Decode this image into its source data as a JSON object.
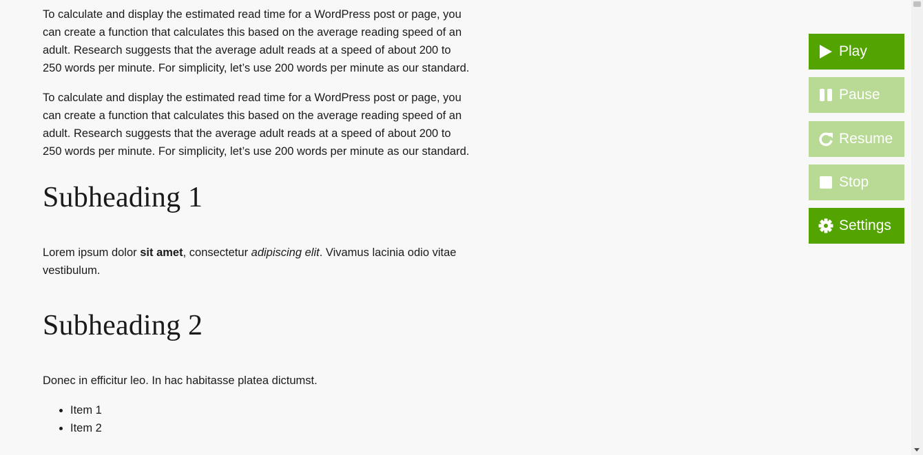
{
  "article": {
    "paragraph_1": "To calculate and display the estimated read time for a WordPress post or page, you can create a function that calculates this based on the average reading speed of an adult. Research suggests that the average adult reads at a speed of about 200 to 250 words per minute. For simplicity, let’s use 200 words per minute as our standard.",
    "paragraph_2": "To calculate and display the estimated read time for a WordPress post or page, you can create a function that calculates this based on the average reading speed of an adult. Research suggests that the average adult reads at a speed of about 200 to 250 words per minute. For simplicity, let’s use 200 words per minute as our standard.",
    "subheading_1": "Subheading 1",
    "lorem": {
      "part_1": "Lorem ipsum dolor ",
      "bold": "sit amet",
      "part_2": ", consectetur ",
      "italic": "adipiscing elit",
      "part_3": ". Vivamus lacinia odio vitae vestibulum."
    },
    "subheading_2": "Subheading 2",
    "paragraph_3": "Donec in efficitur leo. In hac habitasse platea dictumst.",
    "list_items": [
      "Item 1",
      "Item 2"
    ]
  },
  "player": {
    "play_label": "Play",
    "pause_label": "Pause",
    "resume_label": "Resume",
    "stop_label": "Stop",
    "settings_label": "Settings",
    "active_color": "#53a400",
    "disabled_color": "#b8da95"
  }
}
